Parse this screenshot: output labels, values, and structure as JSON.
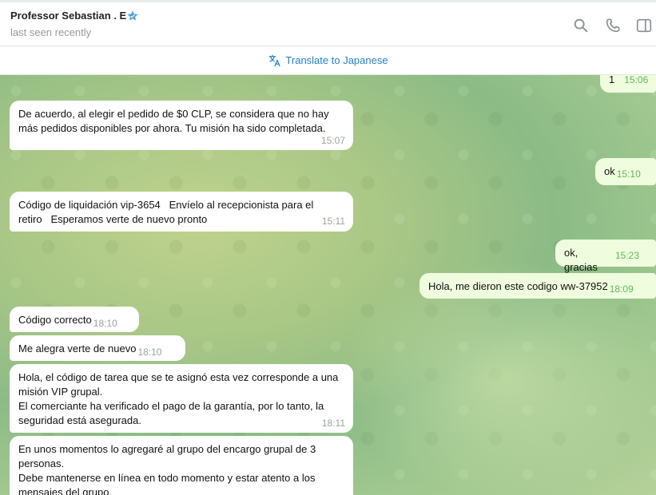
{
  "header": {
    "contact_name": "Professor Sebastian . E",
    "status": "last seen recently",
    "icons": [
      "verified-star-icon",
      "search-icon",
      "phone-icon",
      "sidebar-toggle-icon"
    ]
  },
  "translate": {
    "label": "Translate to Japanese"
  },
  "colors": {
    "accent": "#2481cc",
    "incoming_bubble": "#ffffff",
    "outgoing_bubble": "#effdde",
    "outgoing_time": "#5fb85c"
  },
  "messages": [
    {
      "dir": "out",
      "text": "1",
      "time": "15:06"
    },
    {
      "dir": "in",
      "text": "De acuerdo, al elegir el pedido de $0 CLP, se considera que no hay más pedidos disponibles por ahora. Tu misión ha sido completada.",
      "time": "15:07"
    },
    {
      "dir": "out",
      "text": "ok",
      "time": "15:10"
    },
    {
      "dir": "in",
      "text": "Código de liquidación vip-3654   Envíelo al recepcionista para el retiro   Esperamos verte de nuevo pronto",
      "time": "15:11"
    },
    {
      "dir": "out",
      "text": "ok, gracias",
      "time": "15:23"
    },
    {
      "dir": "out",
      "text": "Hola, me dieron este codigo ww-37952",
      "time": "18:09"
    },
    {
      "dir": "in",
      "text": "Código correcto",
      "time": "18:10"
    },
    {
      "dir": "in",
      "text": "Me alegra verte de nuevo",
      "time": "18:10"
    },
    {
      "dir": "in",
      "text": "Hola, el código de tarea que se te asignó esta vez corresponde a una misión VIP grupal.\nEl comerciante ha verificado el pago de la garantía, por lo tanto, la seguridad está asegurada.",
      "time": "18:11"
    },
    {
      "dir": "in",
      "text": "En unos momentos lo agregaré al grupo del encargo grupal de 3 personas.\nDebe mantenerse en línea en todo momento y estar atento a los mensajes del grupo.",
      "time": ""
    }
  ]
}
